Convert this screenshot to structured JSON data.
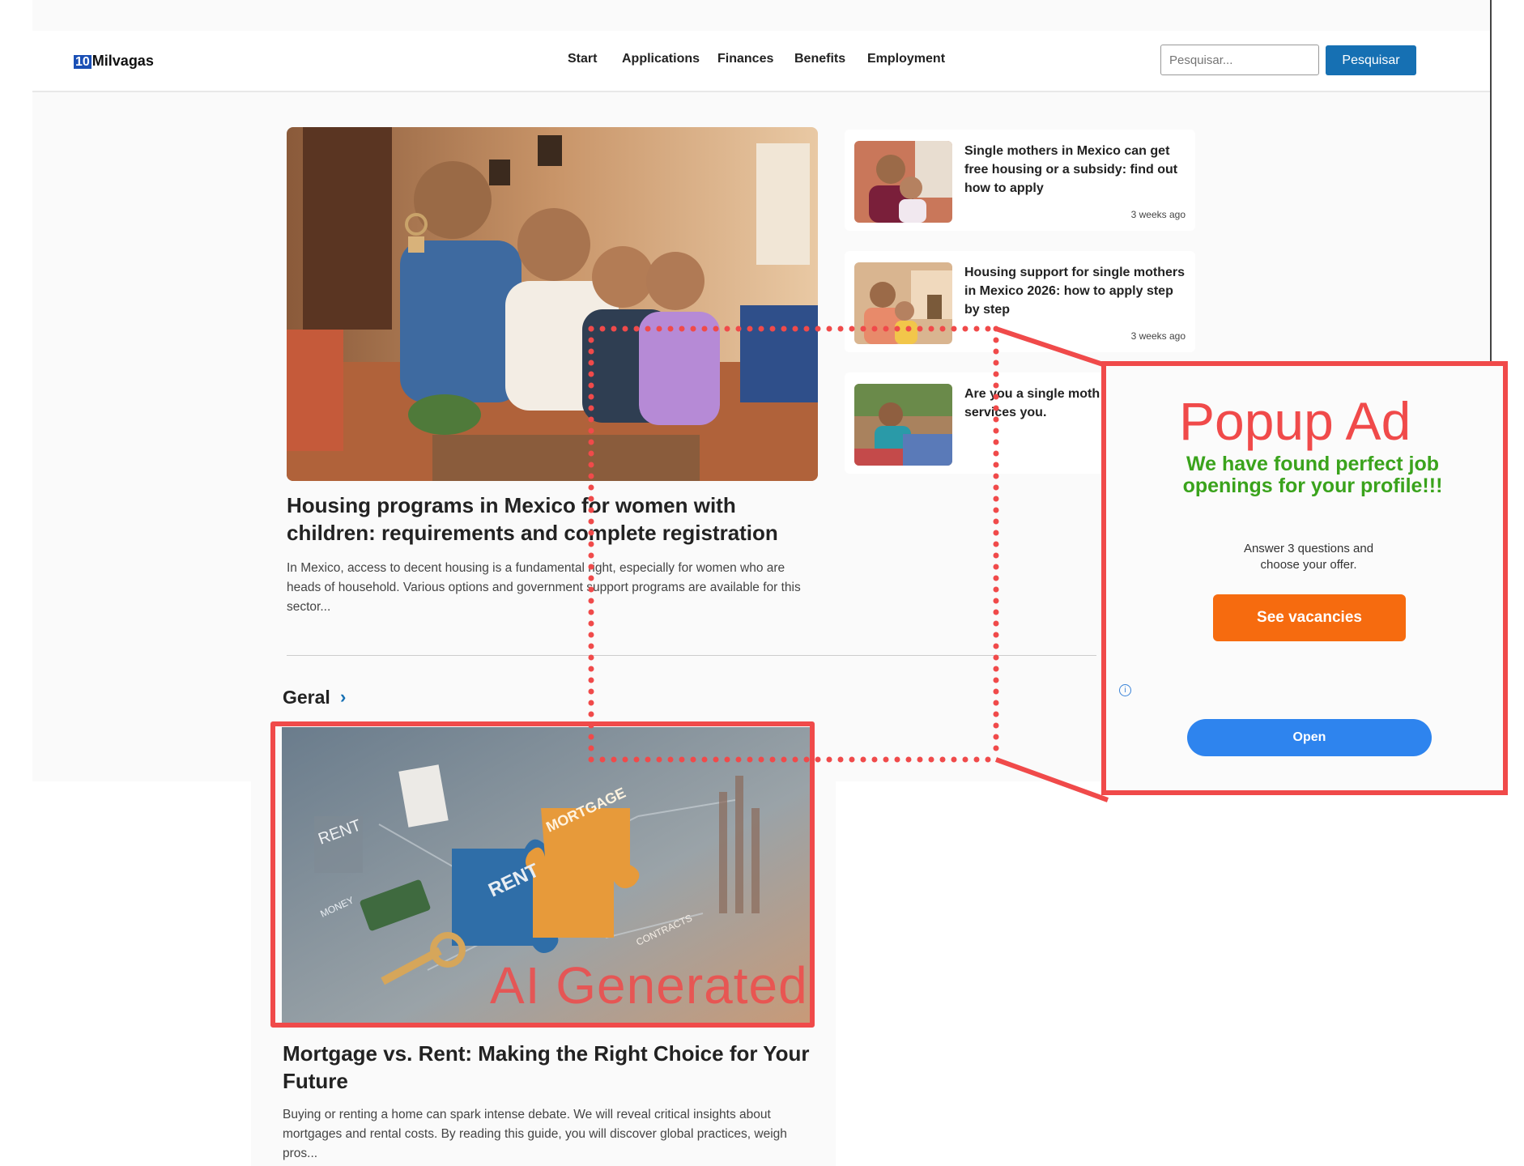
{
  "header": {
    "logo_badge": "10",
    "logo_text": "Milvagas",
    "nav": [
      "Start",
      "Applications",
      "Finances",
      "Benefits",
      "Employment"
    ],
    "search": {
      "placeholder": "Pesquisar...",
      "button_label": "Pesquisar"
    }
  },
  "featured": {
    "title": "Housing programs in Mexico for women with children: requirements and complete registration",
    "excerpt": "In Mexico, access to decent housing is a fundamental right, especially for women who are heads of household. Various options and government support programs are available for this sector..."
  },
  "sidebar_articles": [
    {
      "title": "Single mothers in Mexico can get free housing or a subsidy: find out how to apply",
      "time": "3 weeks ago"
    },
    {
      "title": "Housing support for single mothers in Mexico 2026: how to apply step by step",
      "time": "3 weeks ago"
    },
    {
      "title": "Are you a single moth the support services you.",
      "time": ""
    }
  ],
  "section": {
    "title": "Geral",
    "chevron": "›"
  },
  "article": {
    "title": "Mortgage vs. Rent: Making the Right Choice for Your Future",
    "excerpt": "Buying or renting a home can spark intense debate. We will reveal critical insights about mortgages and rental costs. By reading this guide, you will discover global practices, weigh pros...",
    "image_words": [
      "RENT",
      "MORTGAGE",
      "MONEY",
      "CONTRACTS",
      "RENT"
    ],
    "annotation": "AI Generated"
  },
  "popup": {
    "annotation": "Popup Ad",
    "headline": "We have found perfect job openings for your profile!!!",
    "text": "Answer 3 questions and choose your offer.",
    "cta_label": "See vacancies",
    "info_icon": "i",
    "open_label": "Open"
  },
  "colors": {
    "brand_blue": "#1670b3",
    "annotation_red": "#f04a4a",
    "popup_green": "#3aa31c",
    "cta_orange": "#f66b0f",
    "open_blue": "#2e84ee"
  }
}
